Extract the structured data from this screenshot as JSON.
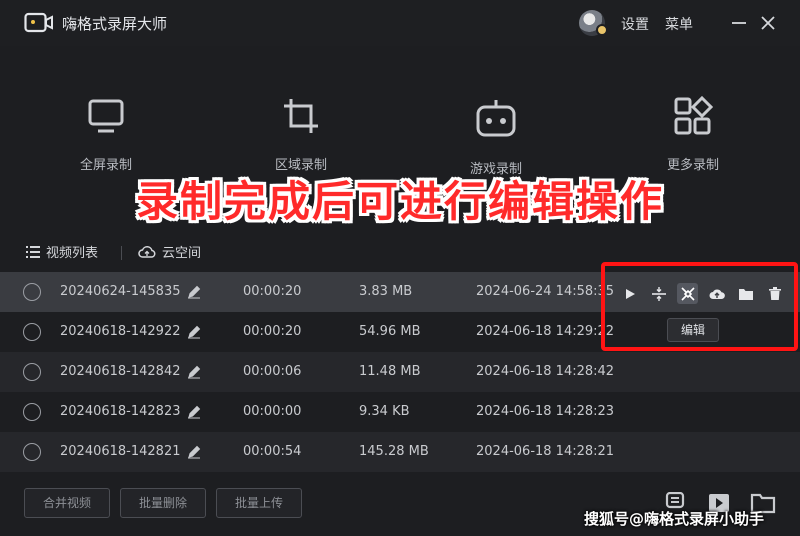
{
  "app": {
    "title": "嗨格式录屏大师"
  },
  "header": {
    "settings_label": "设置",
    "menu_label": "菜单"
  },
  "modes": [
    {
      "label": "全屏录制",
      "icon": "monitor-icon"
    },
    {
      "label": "区域录制",
      "icon": "crop-icon"
    },
    {
      "label": "游戏录制",
      "icon": "gamepad-icon"
    },
    {
      "label": "更多录制",
      "icon": "grid-more-icon"
    }
  ],
  "caption": "录制完成后可进行编辑操作",
  "tabs": {
    "video_list": "视频列表",
    "cloud": "云空间"
  },
  "rows": [
    {
      "name": "20240624-145835",
      "duration": "00:00:20",
      "size": "3.83 MB",
      "date": "2024-06-24 14:58:35"
    },
    {
      "name": "20240618-142922",
      "duration": "00:00:20",
      "size": "54.96 MB",
      "date": "2024-06-18 14:29:22"
    },
    {
      "name": "20240618-142842",
      "duration": "00:00:06",
      "size": "11.48 MB",
      "date": "2024-06-18 14:28:42"
    },
    {
      "name": "20240618-142823",
      "duration": "00:00:00",
      "size": "9.34 KB",
      "date": "2024-06-18 14:28:23"
    },
    {
      "name": "20240618-142821",
      "duration": "00:00:54",
      "size": "145.28 MB",
      "date": "2024-06-18 14:28:21"
    }
  ],
  "row_actions": [
    "play-icon",
    "split-icon",
    "edit-icon",
    "upload-icon",
    "folder-icon",
    "delete-icon"
  ],
  "tooltip": "编辑",
  "bottom": {
    "merge": "合并视频",
    "batch_delete": "批量删除",
    "batch_upload": "批量上传"
  },
  "watermark": "搜狐号@嗨格式录屏小助手",
  "colors": {
    "background": "#1d1e21",
    "caption": "#ff2a2a",
    "highlight": "#ff1414"
  }
}
